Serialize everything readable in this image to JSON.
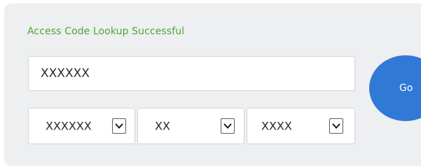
{
  "status": {
    "text": "Access Code Lookup Successful",
    "color": "#4ea436"
  },
  "code_input": {
    "value": "XXXXXX"
  },
  "go_button": {
    "label": "Go",
    "color": "#3179d6"
  },
  "selects": [
    {
      "value": "XXXXXX",
      "icon": "chevron-down-icon"
    },
    {
      "value": "XX",
      "icon": "chevron-down-icon"
    },
    {
      "value": "XXXX",
      "icon": "chevron-down-icon"
    }
  ]
}
